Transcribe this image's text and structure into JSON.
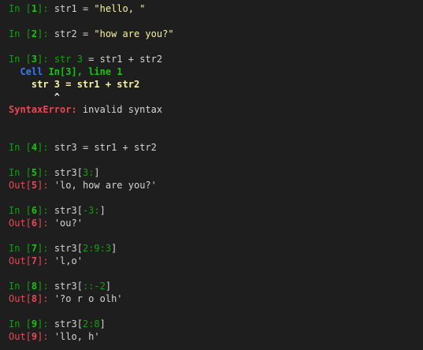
{
  "colors": {
    "background": "#1e1e1e",
    "text": "#d4d4d4",
    "in_prompt": "#16c60c",
    "out_prompt": "#e74856",
    "string": "#f9f1a5",
    "cell_ref": "#3b78ff",
    "error": "#e74856"
  },
  "cells": [
    {
      "in_label": "In [",
      "num": "1",
      "close": "]: ",
      "code_pre": "str1 = ",
      "code_str": "\"hello, \""
    },
    {
      "in_label": "In [",
      "num": "2",
      "close": "]: ",
      "code_pre": "str2 = ",
      "code_str": "\"how are you?\""
    },
    {
      "in_label": "In [",
      "num": "3",
      "close": "]: ",
      "code_pre": "str 3",
      "code_post": " = str1 + str2"
    }
  ],
  "traceback": {
    "cell_word": "Cell ",
    "cell_ref": "In[3], line 1",
    "code_line": "str 3 = str1 + str2",
    "caret": "^",
    "error_name": "SyntaxError:",
    "error_msg": " invalid syntax"
  },
  "cell4": {
    "in_label": "In [",
    "num": "4",
    "close": "]: ",
    "code": "str3 = str1 + str2"
  },
  "slices": [
    {
      "num": "5",
      "code_pre": "str3[",
      "code_arg": "3:",
      "code_post": "]",
      "output": "'lo, how are you?'"
    },
    {
      "num": "6",
      "code_pre": "str3[",
      "code_arg": "-3:",
      "code_post": "]",
      "output": "'ou?'"
    },
    {
      "num": "7",
      "code_pre": "str3[",
      "code_arg": "2:9:3",
      "code_post": "]",
      "output": "'l,o'"
    },
    {
      "num": "8",
      "code_pre": "str3[",
      "code_arg": "::-2",
      "code_post": "]",
      "output": "'?o r o olh'"
    },
    {
      "num": "9",
      "code_pre": "str3[",
      "code_arg": "2:8",
      "code_post": "]",
      "output": "'llo, h'"
    }
  ],
  "labels": {
    "in_open": "In [",
    "in_close": "]: ",
    "out_open": "Out[",
    "out_close": "]: "
  }
}
